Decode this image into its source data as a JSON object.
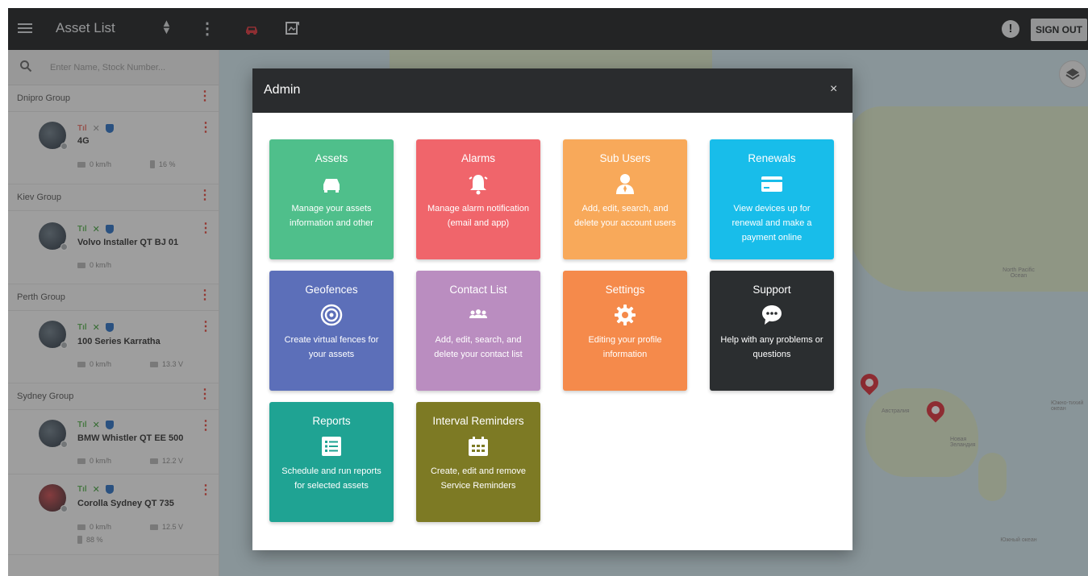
{
  "topbar": {
    "title": "Asset List",
    "sign_out_label": "SIGN OUT",
    "alert_glyph": "!"
  },
  "sidebar": {
    "search_placeholder": "Enter Name, Stock Number...",
    "groups": [
      {
        "name": "Dnipro Group",
        "assets": [
          {
            "name": "4G",
            "speed": "0 km/h",
            "battery": "16 %"
          }
        ]
      },
      {
        "name": "Kiev Group",
        "assets": [
          {
            "name": "Volvo Installer QT BJ 01",
            "speed": "0 km/h"
          }
        ]
      },
      {
        "name": "Perth Group",
        "assets": [
          {
            "name": "100 Series Karratha",
            "speed": "0 km/h",
            "voltage": "13.3 V"
          }
        ]
      },
      {
        "name": "Sydney Group",
        "assets": [
          {
            "name": "BMW Whistler QT EE 500",
            "speed": "0 km/h",
            "voltage": "12.2 V"
          },
          {
            "name": "Corolla Sydney QT 735",
            "speed": "0 km/h",
            "voltage": "12.5 V",
            "battery": "88 %"
          }
        ]
      }
    ]
  },
  "map": {
    "labels": [
      "North Pacific Ocean",
      "Южно-тихий океан",
      "Австралия",
      "Новая Зеландия",
      "Южный океан"
    ]
  },
  "modal": {
    "title": "Admin",
    "close_glyph": "×",
    "tiles": [
      {
        "title": "Assets",
        "icon": "car-icon",
        "color": "#4fbf8b",
        "desc": "Manage your assets information and other"
      },
      {
        "title": "Alarms",
        "icon": "bell-icon",
        "color": "#f0656b",
        "desc": "Manage alarm notification (email and app)"
      },
      {
        "title": "Sub Users",
        "icon": "user-icon",
        "color": "#f8a95a",
        "desc": "Add, edit, search, and delete your account users"
      },
      {
        "title": "Renewals",
        "icon": "credit-card-icon",
        "color": "#18bdea",
        "desc": "View devices up for renewal and make a payment online"
      },
      {
        "title": "Geofences",
        "icon": "geofence-icon",
        "color": "#5c6fb9",
        "desc": "Create virtual fences for your assets"
      },
      {
        "title": "Contact List",
        "icon": "contacts-icon",
        "color": "#ba8dc0",
        "desc": "Add, edit, search, and delete your contact list"
      },
      {
        "title": "Settings",
        "icon": "gear-icon",
        "color": "#f58a4b",
        "desc": "Editing your profile information"
      },
      {
        "title": "Support",
        "icon": "chat-icon",
        "color": "#2b2e30",
        "desc": "Help with any problems or questions"
      },
      {
        "title": "Reports",
        "icon": "list-icon",
        "color": "#1fa393",
        "desc": "Schedule and run reports for selected assets"
      },
      {
        "title": "Interval Reminders",
        "icon": "calendar-icon",
        "color": "#7d7a24",
        "desc": "Create, edit and remove Service Reminders"
      }
    ]
  }
}
